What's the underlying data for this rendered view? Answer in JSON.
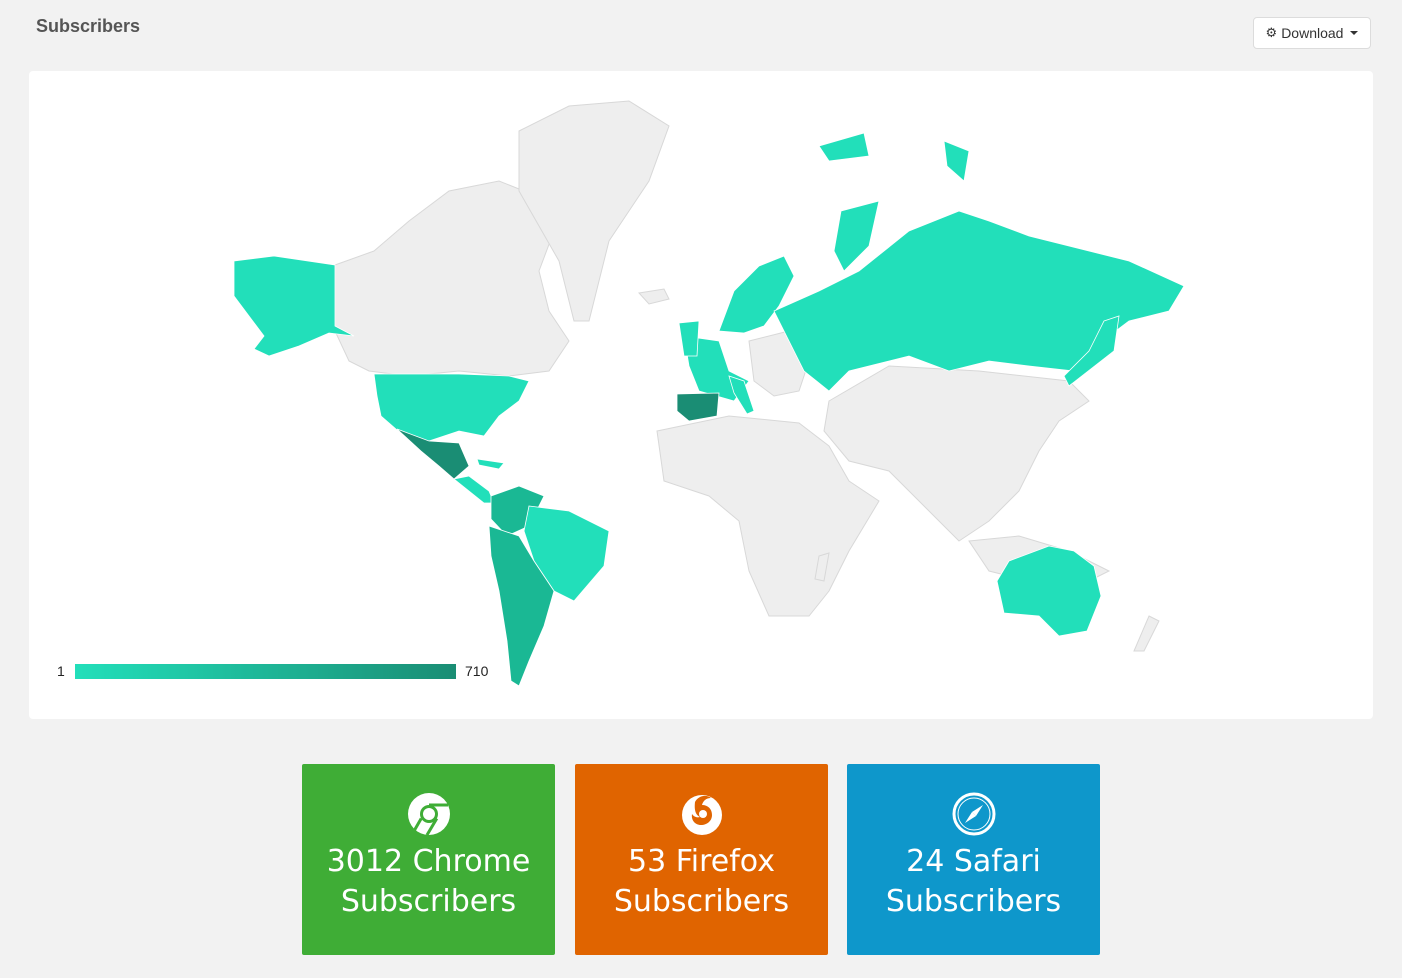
{
  "header": {
    "title": "Subscribers",
    "download_label": "Download"
  },
  "map": {
    "legend_min": "1",
    "legend_max": "710",
    "colors": {
      "low": "#22dfba",
      "mid": "#1ab894",
      "high": "#1a8d74",
      "no_data": "#eeeeee"
    }
  },
  "stats": [
    {
      "line1": "3012 Chrome",
      "line2": "Subscribers",
      "icon": "chrome-icon",
      "color": "#3fad36"
    },
    {
      "line1": "53 Firefox",
      "line2": "Subscribers",
      "icon": "firefox-icon",
      "color": "#e06400"
    },
    {
      "line1": "24 Safari",
      "line2": "Subscribers",
      "icon": "safari-icon",
      "color": "#0e97cb"
    }
  ]
}
